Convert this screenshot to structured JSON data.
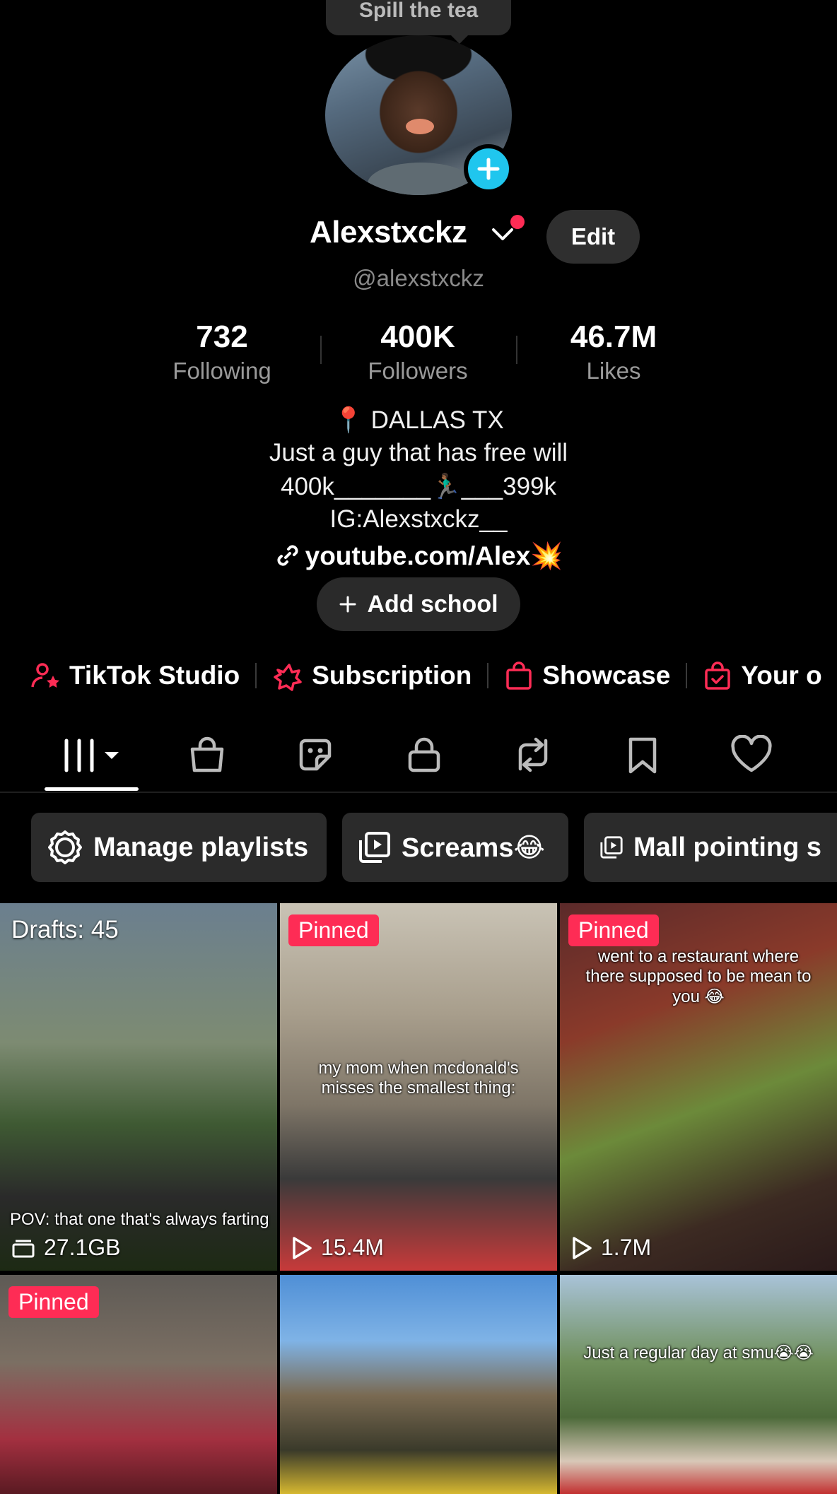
{
  "header": {
    "bubble_text": "Spill the tea"
  },
  "profile": {
    "display_name": "Alexstxckz",
    "handle": "@alexstxckz",
    "edit_label": "Edit"
  },
  "stats": [
    {
      "value": "732",
      "label": "Following"
    },
    {
      "value": "400K",
      "label": "Followers"
    },
    {
      "value": "46.7M",
      "label": "Likes"
    }
  ],
  "bio": {
    "lines": [
      "📍 DALLAS TX",
      "Just a guy that has free will",
      "400k_______🏃🏾‍♂️___399k",
      "IG:Alexstxckz__"
    ],
    "link": "youtube.com/Alex💥",
    "add_school_label": "Add school"
  },
  "tools": [
    {
      "label": "TikTok Studio",
      "icon": "studio-icon"
    },
    {
      "label": "Subscription",
      "icon": "subscription-icon"
    },
    {
      "label": "Showcase",
      "icon": "showcase-bag-icon"
    },
    {
      "label": "Your o",
      "icon": "orders-icon"
    }
  ],
  "tabs": [
    "videos-grid-icon",
    "shop-bag-icon",
    "sticker-icon",
    "lock-icon",
    "repost-icon",
    "bookmark-icon",
    "heart-icon"
  ],
  "playlists": [
    {
      "label": "Manage playlists",
      "icon": "gear-icon"
    },
    {
      "label": "Screams😂",
      "icon": "playlist-icon"
    },
    {
      "label": "Mall pointing s",
      "icon": "playlist-icon"
    }
  ],
  "videos": [
    {
      "badge": "Drafts: 45",
      "caption": "POV: that one that's always farting",
      "stat": "27.1GB",
      "stat_icon": "drafts-box-icon"
    },
    {
      "badge": "Pinned",
      "caption": "my mom when mcdonald's misses the smallest thing:",
      "stat": "15.4M",
      "stat_icon": "play-icon"
    },
    {
      "badge": "Pinned",
      "caption": "went to a restaurant where there supposed to be mean to you 😂",
      "stat": "1.7M",
      "stat_icon": "play-icon"
    },
    {
      "badge": "Pinned",
      "caption": "",
      "stat": "",
      "stat_icon": ""
    },
    {
      "badge": "",
      "caption": "",
      "stat": "",
      "stat_icon": ""
    },
    {
      "badge": "",
      "caption": "Just a regular day at smu😭😭",
      "stat": "",
      "stat_icon": ""
    }
  ],
  "colors": {
    "accent": "#fe2c55",
    "add_button": "#20c6ee",
    "background": "#000000"
  }
}
